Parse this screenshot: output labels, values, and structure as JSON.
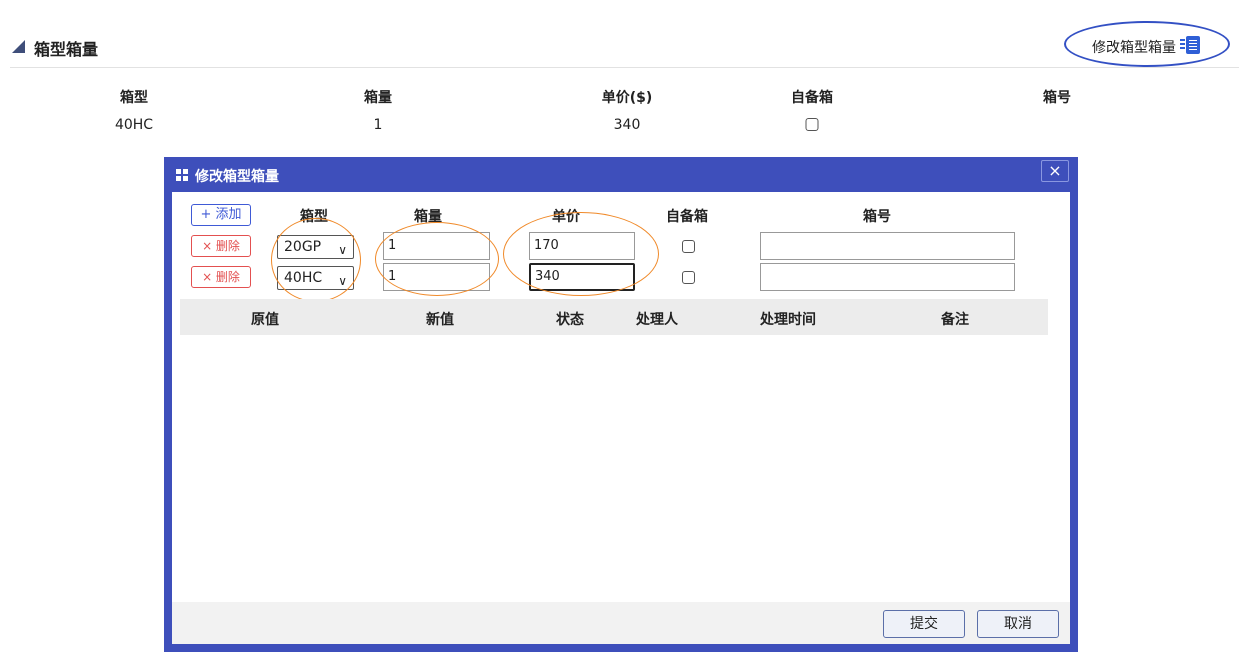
{
  "section": {
    "title": "箱型箱量",
    "edit_link": "修改箱型箱量"
  },
  "summary": {
    "headers": [
      "箱型",
      "箱量",
      "单价($)",
      "自备箱",
      "箱号"
    ],
    "row": {
      "type": "40HC",
      "qty": "1",
      "price": "340",
      "own": false,
      "no": ""
    }
  },
  "dialog": {
    "title": "修改箱型箱量",
    "close": "×",
    "add_label": "+ 添加",
    "delete_label": "× 删除",
    "columns": [
      "箱型",
      "箱量",
      "单价",
      "自备箱",
      "箱号"
    ],
    "rows": [
      {
        "type": "20GP",
        "qty": "1",
        "price": "170",
        "own": false,
        "no": ""
      },
      {
        "type": "40HC",
        "qty": "1",
        "price": "340",
        "own": false,
        "no": ""
      }
    ],
    "history_headers": [
      "原值",
      "新值",
      "状态",
      "处理人",
      "处理时间",
      "备注"
    ],
    "submit": "提交",
    "cancel": "取消"
  },
  "colors": {
    "dialog_frame": "#3e4fbb",
    "add_button": "#3f5ad6",
    "delete_button": "#e35050",
    "highlight_circle": "#f08a2a",
    "edit_link_ring": "#3350c4"
  },
  "icons": [
    "section-marker-icon",
    "edit-list-icon",
    "dialog-grid-icon",
    "chevron-down-icon",
    "close-icon"
  ]
}
